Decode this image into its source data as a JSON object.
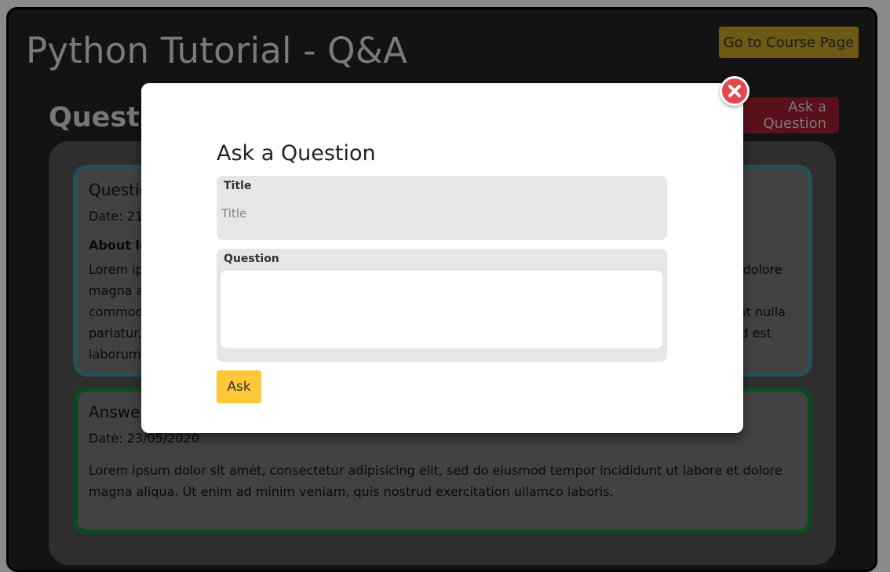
{
  "header": {
    "title": "Python Tutorial - Q&A",
    "course_button": "Go to Course Page"
  },
  "section": {
    "title": "Questions",
    "ask_button": "Ask a Question"
  },
  "question_card": {
    "heading": "Question",
    "date": "Date: 21/",
    "subheading": "About lo",
    "body": "Lorem ipsum dolor sit amet, consectetur adipisicing elit, sed do eiusmod tempor incididunt ut labore et dolore magna aliqua. Ut enim ad minim veniam, quis nostrud exercitation ullamco laboris nisi ut aliquip ex ea commodo consequat. Duis aute irure dolor in reprehenderit in voluptate velit esse cillum dolore eu fugiat nulla pariatur. Excepteur sint occaecat cupidatat non proident, sunt in culpa qui officia deserunt mollit anim id est laborum."
  },
  "answer_card": {
    "heading": "Answer",
    "date": "Date: 23/05/2020",
    "body": "Lorem ipsum dolor sit amet, consectetur adipisicing elit, sed do eiusmod tempor incididunt ut labore et dolore magna aliqua. Ut enim ad minim veniam, quis nostrud exercitation ullamco laboris."
  },
  "modal": {
    "title": "Ask a Question",
    "title_label": "Title",
    "title_placeholder": "Title",
    "question_label": "Question",
    "question_value": "",
    "submit_label": "Ask",
    "close_icon": "close-x-icon"
  },
  "colors": {
    "course_button": "#ffc107",
    "ask_button": "#dc3545",
    "question_border": "#17a2b8",
    "answer_border": "#28a745",
    "close_button": "#e4474d"
  }
}
